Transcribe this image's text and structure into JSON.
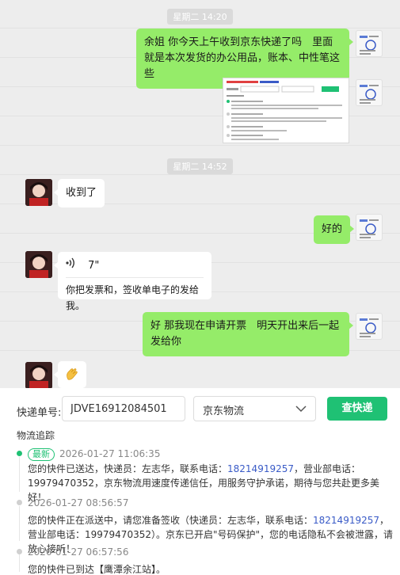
{
  "chat": {
    "timestamps": [
      "星期二 14:20",
      "星期二 14:52"
    ],
    "messages": [
      {
        "from": "me",
        "text": "余姐 你今天上午收到京东快递了吗　里面就是本次发货的办公用品，账本、中性笔这些"
      },
      {
        "from": "me",
        "type": "image"
      },
      {
        "from": "other",
        "text": "收到了"
      },
      {
        "from": "me",
        "text": "好的"
      },
      {
        "from": "other",
        "type": "voice",
        "duration": "7\"",
        "transcript": "你把发票和，签收单电子的发给我。"
      },
      {
        "from": "me",
        "text": "好 那我现在申请开票　明天开出来后一起发给你"
      },
      {
        "from": "other",
        "type": "emoji",
        "icon": "clapping-hands-icon"
      }
    ]
  },
  "tracker": {
    "label": "快递单号:",
    "tracking_number": "JDVE16912084501",
    "carrier": "京东物流",
    "button": "查快递",
    "section_title": "物流追踪",
    "events": [
      {
        "badge": "最新",
        "time": "2026-01-27 11:06:35",
        "text_a": "您的快件已送达，快递员：左志华，联系电话：",
        "phone": "18214919257",
        "text_b": "，营业部电话：19979470352，京东物流用速度传递信任，用服务守护承诺，期待与您共赴更多美好！"
      },
      {
        "time": "2026-01-27 08:56:57",
        "text_a": "您的快件正在派送中，请您准备签收（快递员：左志华，联系电话：",
        "phone": "18214919257",
        "text_b": "，营业部电话：19979470352）。京东已开启\"号码保护\"，您的电话隐私不会被泄露，请放心接听！"
      },
      {
        "time": "2026-01-27 06:57:56",
        "text_a": "您的快件已到达【鹰潭余江站】。"
      }
    ]
  },
  "colors": {
    "bubble_me": "#95ec69",
    "accent": "#1fc174",
    "link": "#3a5bc7"
  }
}
